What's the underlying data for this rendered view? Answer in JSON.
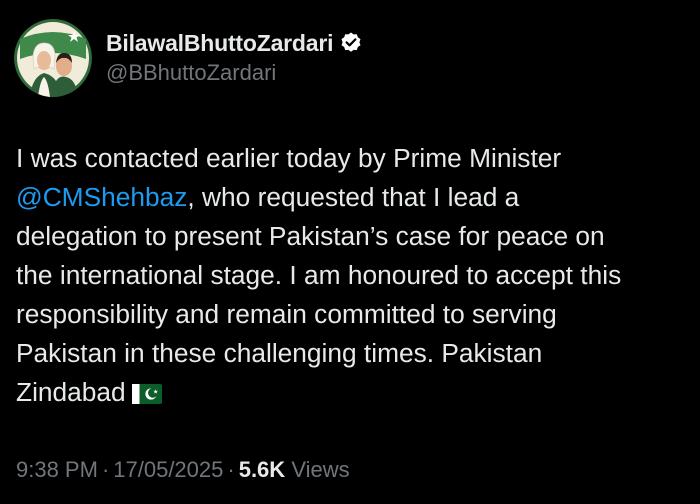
{
  "author": {
    "display_name": "BilawalBhuttoZardari",
    "handle": "@BBhuttoZardari",
    "verified": true,
    "avatar_icon": "profile-avatar"
  },
  "post": {
    "line1": "I was contacted earlier today by Prime Minister",
    "mention": "@CMShehbaz",
    "line2_rest": ", who requested that I lead a",
    "line3": "delegation to present Pakistan’s case for peace on",
    "line4": "the international stage. I am honoured to accept this",
    "line5": "responsibility and remain committed to serving",
    "line6": "Pakistan in these challenging times. Pakistan",
    "line7": "Zindabad",
    "emoji": "pakistan-flag-emoji"
  },
  "meta": {
    "time": "9:38 PM",
    "date": "17/05/2025",
    "separator": "·",
    "views_count": "5.6K",
    "views_label": "Views"
  },
  "colors": {
    "background": "#000000",
    "text": "#e7e9ea",
    "muted": "#71767b",
    "link": "#1d9bf0",
    "verified_badge": "#ffffff"
  }
}
